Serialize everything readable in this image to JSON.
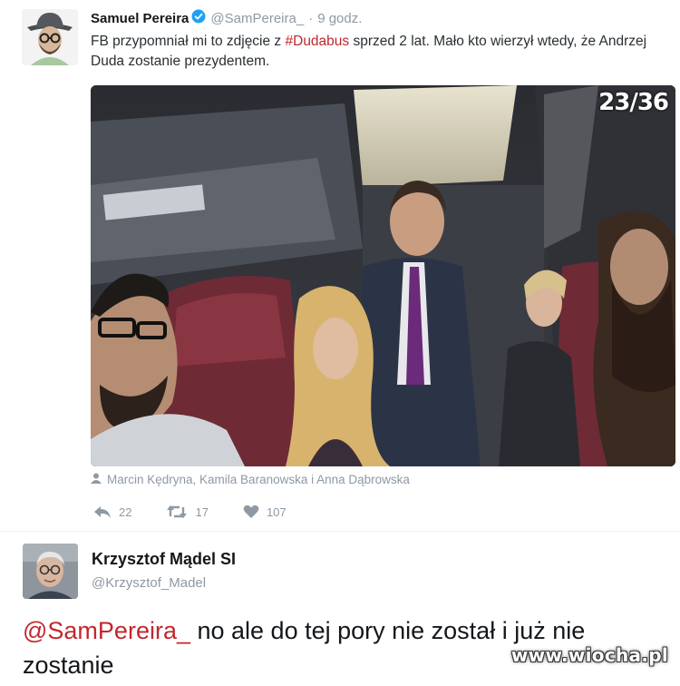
{
  "tweet1": {
    "name": "Samuel Pereira",
    "handle": "@SamPereira_",
    "separator": "·",
    "time": "9 godz.",
    "text_before": "FB przypomniał mi to zdjęcie z ",
    "hashtag": "#Dudabus",
    "text_after": " sprzed 2 lat. Mało kto wierzył wtedy, że Andrzej Duda zostanie prezydentem.",
    "photo_counter": "23/36",
    "tagged": "Marcin Kędryna, Kamila Baranowska i Anna Dąbrowska",
    "actions": {
      "reply_count": "22",
      "retweet_count": "17",
      "like_count": "107"
    },
    "icons": {
      "verified": "verified-badge-icon",
      "person": "person-icon",
      "reply": "reply-icon",
      "retweet": "retweet-icon",
      "like": "heart-icon"
    }
  },
  "tweet2": {
    "name": "Krzysztof Mądel SI",
    "handle": "@Krzysztof_Madel",
    "mention": "@SamPereira_",
    "text": " no ale do tej pory nie został i już nie zostanie"
  },
  "watermark": "www.wiocha.pl",
  "colors": {
    "accent": "#c1272d",
    "verified": "#1da1f2",
    "muted": "#8e99a3",
    "text": "#14171a"
  }
}
